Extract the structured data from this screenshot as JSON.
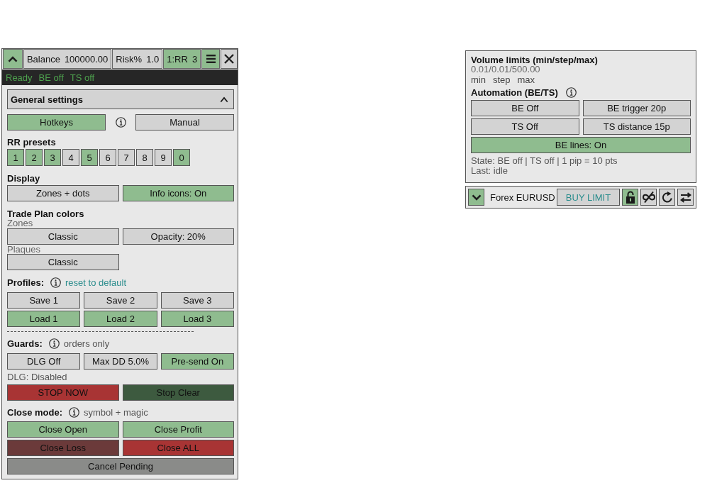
{
  "trade_panel": {
    "header": {
      "collapse_button": {
        "on": true,
        "expanded": true
      },
      "stats": [
        {
          "label": "Balance",
          "value": "100000.00",
          "on": false
        },
        {
          "label": "Risk%",
          "value": "1.0",
          "on": false
        },
        {
          "label": "1:RR",
          "value": "3",
          "on": true
        }
      ],
      "menu_button": {
        "on": true
      },
      "close_button": {
        "on": false
      }
    },
    "status": [
      "Ready",
      "BE off",
      "TS off"
    ],
    "general_settings": {
      "title": "General settings",
      "expanded": true
    },
    "input_mode": [
      {
        "label": "Hotkeys",
        "selected": true
      },
      {
        "label": "Manual",
        "selected": false
      }
    ],
    "rr_presets": {
      "title": "RR presets",
      "presets": [
        {
          "label": "1",
          "selected": true
        },
        {
          "label": "2",
          "selected": true
        },
        {
          "label": "3",
          "selected": true
        },
        {
          "label": "4",
          "selected": false
        },
        {
          "label": "5",
          "selected": true
        },
        {
          "label": "6",
          "selected": false
        },
        {
          "label": "7",
          "selected": false
        },
        {
          "label": "8",
          "selected": false
        },
        {
          "label": "9",
          "selected": false
        },
        {
          "label": "0",
          "selected": true
        }
      ]
    },
    "display": {
      "title": "Display",
      "buttons": [
        {
          "label": "Zones + dots",
          "on": false
        },
        {
          "label": "Info icons: On",
          "on": true
        }
      ]
    },
    "trade_plan_colors": {
      "title": "Trade Plan colors",
      "rows": [
        {
          "label": "Zones",
          "buttons": [
            "Classic",
            "Opacity: 20%"
          ]
        },
        {
          "label": "Plaques",
          "buttons": [
            "Classic"
          ]
        }
      ]
    },
    "profiles": {
      "title": "Profiles:",
      "link": "reset to default",
      "buttons": [
        {
          "label": "Save 1",
          "color": "#d3d3d3"
        },
        {
          "label": "Save 2",
          "color": "#d3d3d3"
        },
        {
          "label": "Save 3",
          "color": "#d3d3d3"
        },
        {
          "label": "Load 1",
          "color": "#8fbc8f"
        },
        {
          "label": "Load 2",
          "color": "#8fbc8f"
        },
        {
          "label": "Load 3",
          "color": "#8fbc8f"
        }
      ]
    },
    "guards": {
      "title": "Guards:",
      "note": "orders only",
      "buttons": [
        {
          "label": "DLG Off",
          "on": false
        },
        {
          "label": "Max DD 5.0%",
          "on": false
        },
        {
          "label": "Pre-send On",
          "on": true
        }
      ],
      "status": "DLG: Disabled",
      "actions": [
        {
          "label": "STOP NOW",
          "color": "#a83434"
        },
        {
          "label": "Stop Clear",
          "color": "#3d5a3f"
        }
      ]
    },
    "close_mode": {
      "title": "Close mode:",
      "note": "symbol + magic",
      "buttons": [
        {
          "label": "Close Open",
          "color": "#8fbc8f"
        },
        {
          "label": "Close Profit",
          "color": "#8fbc8f"
        },
        {
          "label": "Close Loss",
          "color": "#6b3a3a"
        },
        {
          "label": "Close ALL",
          "color": "#a83434"
        },
        {
          "label": "Cancel Pending",
          "color": "#8a8b89"
        }
      ]
    }
  },
  "volume_panel": {
    "title": "Volume limits (min/step/max)",
    "values": "0.01/0.01/500.00",
    "hints": [
      "min",
      "step",
      "max"
    ],
    "automation": {
      "title": "Automation (BE/TS)",
      "buttons": [
        {
          "label": "BE Off",
          "on": false
        },
        {
          "label": "BE trigger 20p",
          "on": false
        },
        {
          "label": "TS Off",
          "on": false
        },
        {
          "label": "TS distance 15p",
          "on": false
        },
        {
          "label": "BE lines: On",
          "on": true
        }
      ]
    },
    "state": "State: BE off | TS off | 1 pip = 10 pts",
    "last": "Last: idle"
  },
  "symbol_bar": {
    "expand_button": {
      "on": true,
      "expanded": false
    },
    "symbol": "Forex EURUSD",
    "order_button": "BUY LIMIT",
    "tools": [
      {
        "kind": "lock",
        "on": true
      },
      {
        "kind": "infinity",
        "on": false
      },
      {
        "kind": "refresh",
        "on": false
      },
      {
        "kind": "swap",
        "on": false
      }
    ]
  }
}
